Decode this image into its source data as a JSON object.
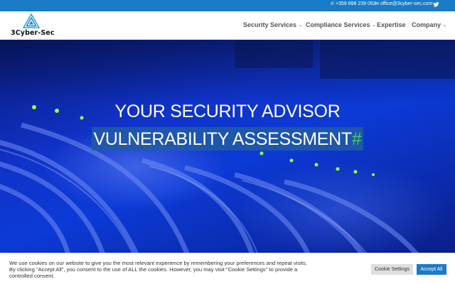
{
  "topbar": {
    "phone": "+359 898 239 053",
    "email": "office@3cyber-sec.com",
    "phone_icon": "phone-icon",
    "email_icon": "envelope-icon",
    "social_icon": "twitter-icon"
  },
  "header": {
    "logo_text": "3Cyber-Sec",
    "nav": [
      {
        "label": "Security Services",
        "has_dropdown": true
      },
      {
        "label": "Compliance Services",
        "has_dropdown": true
      },
      {
        "label": "Expertise",
        "has_dropdown": false
      },
      {
        "label": "Company",
        "has_dropdown": true
      }
    ]
  },
  "hero": {
    "title": "YOUR SECURITY ADVISOR",
    "typed_text": "VULNERABILITY ASSESSMENT",
    "cursor": "#"
  },
  "cookie_banner": {
    "text": "We use cookies on our website to give you the most relevant experience by remembering your preferences and repeat visits. By clicking “Accept All”, you consent to the use of ALL the cookies. However, you may visit \"Cookie Settings\" to provide a controlled consent.",
    "settings_label": "Cookie Settings",
    "accept_label": "Accept All"
  },
  "colors": {
    "brand_blue": "#1a7bc6",
    "hero_blue": "#1033c9",
    "cursor_green": "#4cc96a",
    "nav_text": "#555555"
  }
}
